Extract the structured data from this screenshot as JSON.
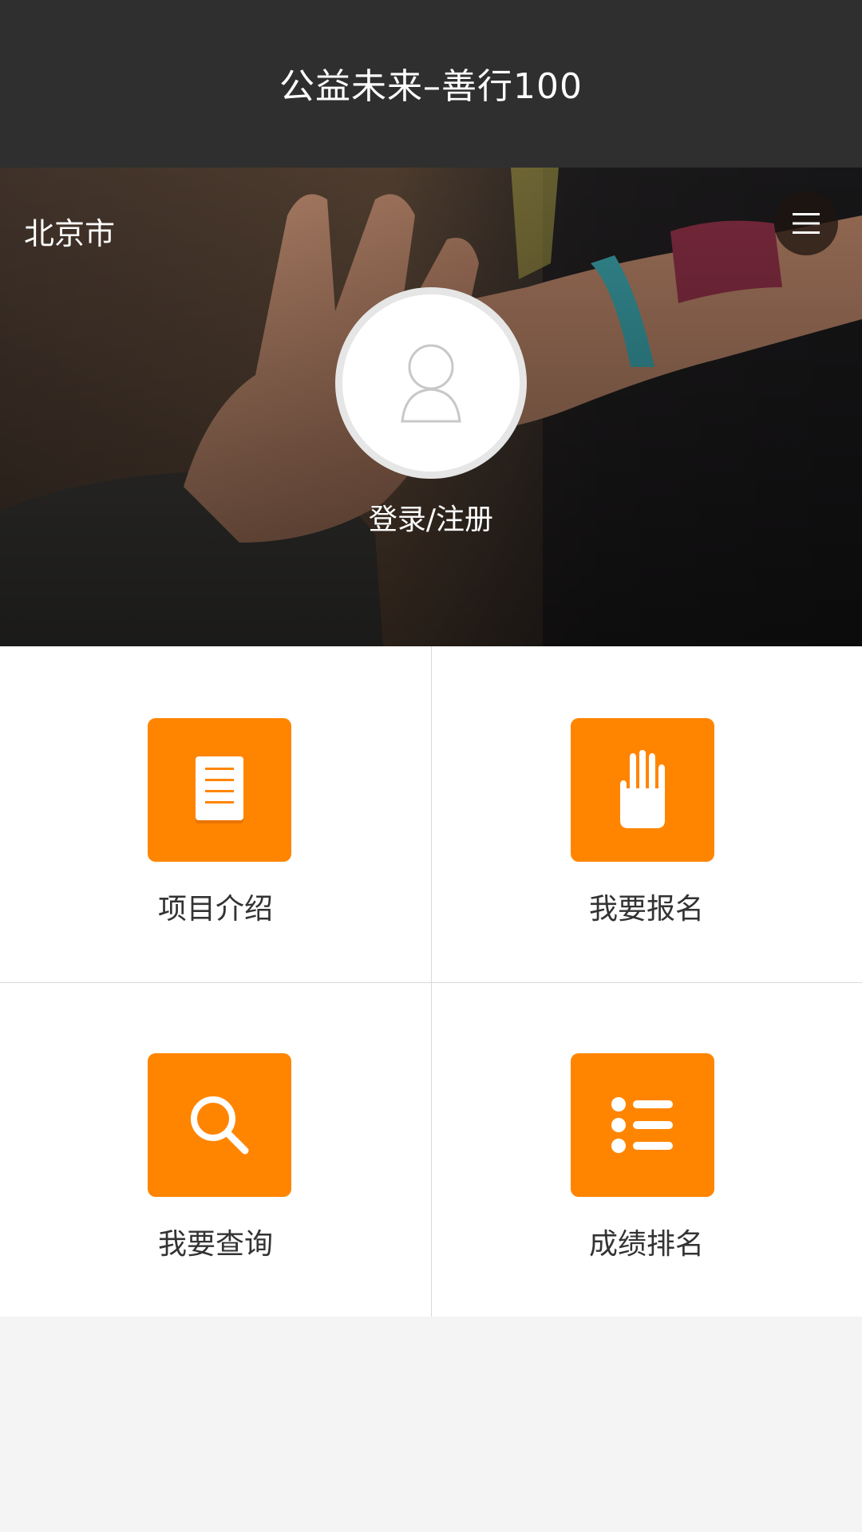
{
  "header": {
    "title": "公益未来–善行100"
  },
  "hero": {
    "city": "北京市",
    "login_label": "登录/注册"
  },
  "menu": [
    {
      "label": "项目介绍",
      "icon": "document-icon"
    },
    {
      "label": "我要报名",
      "icon": "raised-hand-icon"
    },
    {
      "label": "我要查询",
      "icon": "search-icon"
    },
    {
      "label": "成绩排名",
      "icon": "list-icon"
    }
  ],
  "colors": {
    "header_bg": "#2f2f2f",
    "accent": "#ff8500",
    "page_bg": "#f4f4f4",
    "label_text": "#333333"
  }
}
